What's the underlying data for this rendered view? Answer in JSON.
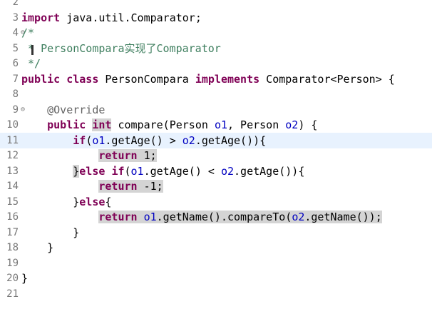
{
  "editor": {
    "current_line": 11,
    "lines": [
      {
        "n": "2"
      },
      {
        "n": "3",
        "tokens": [
          {
            "k": "kw",
            "t": "import"
          },
          {
            "t": " java.util.Comparator;"
          }
        ]
      },
      {
        "n": "4",
        "fold": "⊖",
        "tokens": [
          {
            "k": "cm",
            "t": "/*"
          }
        ]
      },
      {
        "n": "5",
        "tokens": [
          {
            "k": "cm",
            "t": " * PersonCompara实现了Comparator"
          }
        ]
      },
      {
        "n": "6",
        "tokens": [
          {
            "k": "cm",
            "t": " */"
          }
        ]
      },
      {
        "n": "7",
        "tokens": [
          {
            "k": "kw",
            "t": "public"
          },
          {
            "t": " "
          },
          {
            "k": "kw",
            "t": "class"
          },
          {
            "t": " PersonCompara "
          },
          {
            "k": "kw",
            "t": "implements"
          },
          {
            "t": " Comparator<Person> {"
          }
        ]
      },
      {
        "n": "8"
      },
      {
        "n": "9",
        "fold": "⊖",
        "tokens": [
          {
            "t": "    "
          },
          {
            "k": "an",
            "t": "@Override"
          }
        ]
      },
      {
        "n": "10",
        "tokens": [
          {
            "t": "    "
          },
          {
            "k": "kw",
            "t": "public"
          },
          {
            "t": " "
          },
          {
            "k": "kw hl",
            "t": "int"
          },
          {
            "t": " compare(Person "
          },
          {
            "k": "pv",
            "t": "o1"
          },
          {
            "t": ", Person "
          },
          {
            "k": "pv",
            "t": "o2"
          },
          {
            "t": ") {"
          }
        ]
      },
      {
        "n": "11",
        "tokens": [
          {
            "t": "        "
          },
          {
            "k": "kw",
            "t": "if"
          },
          {
            "t": "("
          },
          {
            "k": "pv",
            "t": "o1"
          },
          {
            "t": ".getAge() > "
          },
          {
            "k": "pv",
            "t": "o2"
          },
          {
            "t": ".getAge()){"
          }
        ]
      },
      {
        "n": "12",
        "tokens": [
          {
            "t": "            "
          },
          {
            "k": "kw occ",
            "t": "return"
          },
          {
            "k": "occ",
            "t": " 1;"
          }
        ]
      },
      {
        "n": "13",
        "tokens": [
          {
            "t": "        "
          },
          {
            "k": "occ",
            "t": "}"
          },
          {
            "k": "kw",
            "t": "else"
          },
          {
            "t": " "
          },
          {
            "k": "kw",
            "t": "if"
          },
          {
            "t": "("
          },
          {
            "k": "pv",
            "t": "o1"
          },
          {
            "t": ".getAge() < "
          },
          {
            "k": "pv",
            "t": "o2"
          },
          {
            "t": ".getAge()){"
          }
        ]
      },
      {
        "n": "14",
        "tokens": [
          {
            "t": "            "
          },
          {
            "k": "kw occ",
            "t": "return"
          },
          {
            "k": "occ",
            "t": " -1;"
          }
        ]
      },
      {
        "n": "15",
        "tokens": [
          {
            "t": "        }"
          },
          {
            "k": "kw",
            "t": "else"
          },
          {
            "t": "{"
          }
        ]
      },
      {
        "n": "16",
        "tokens": [
          {
            "t": "            "
          },
          {
            "k": "kw occ",
            "t": "return"
          },
          {
            "k": "occ",
            "t": " "
          },
          {
            "k": "pv occ",
            "t": "o1"
          },
          {
            "k": "occ",
            "t": ".getName().compareTo("
          },
          {
            "k": "pv occ",
            "t": "o2"
          },
          {
            "k": "occ",
            "t": ".getName());"
          }
        ]
      },
      {
        "n": "17",
        "tokens": [
          {
            "t": "        }"
          }
        ]
      },
      {
        "n": "18",
        "tokens": [
          {
            "t": "    }"
          }
        ]
      },
      {
        "n": "19"
      },
      {
        "n": "20",
        "tokens": [
          {
            "t": "}"
          }
        ]
      },
      {
        "n": "21"
      }
    ]
  }
}
